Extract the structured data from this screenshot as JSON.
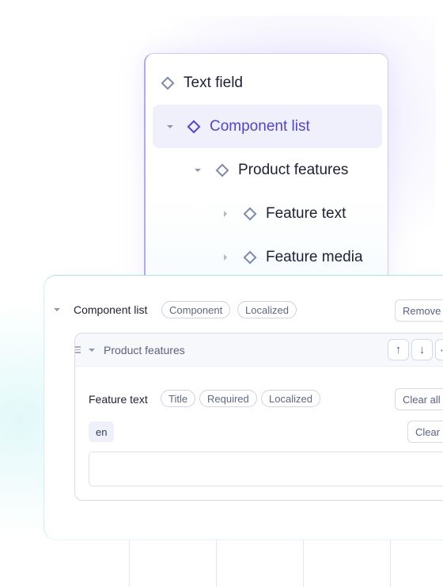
{
  "tree": {
    "items": [
      {
        "label": "Text field",
        "icon": "diamond-icon",
        "expanded": null,
        "active": false
      },
      {
        "label": "Component list",
        "icon": "diamond-icon",
        "expanded": true,
        "active": true
      },
      {
        "label": "Product features",
        "icon": "diamond-icon",
        "expanded": true,
        "active": false
      },
      {
        "label": "Feature text",
        "icon": "diamond-icon",
        "expanded": false,
        "active": false
      },
      {
        "label": "Feature media",
        "icon": "diamond-icon",
        "expanded": false,
        "active": false
      }
    ]
  },
  "editor": {
    "field_label": "Component list",
    "badges": [
      "Component",
      "Localized"
    ],
    "remove_label": "Remove",
    "block": {
      "title": "Product features",
      "move_up_icon": "arrow-up-icon",
      "move_down_icon": "arrow-down-icon",
      "more_icon": "more-icon",
      "up_glyph": "↑",
      "down_glyph": "↓",
      "more_glyph": "⋯",
      "field": {
        "label": "Feature text",
        "badges": [
          "Title",
          "Required",
          "Localized"
        ],
        "clear_all_label": "Clear all",
        "locale": "en",
        "clear_label": "Clear",
        "value": ""
      }
    }
  },
  "colors": {
    "accent": "#5143d5",
    "active_bg": "#f0effc",
    "tree_border": "#b2aaf0",
    "editor_border": "#a7e3e6"
  }
}
